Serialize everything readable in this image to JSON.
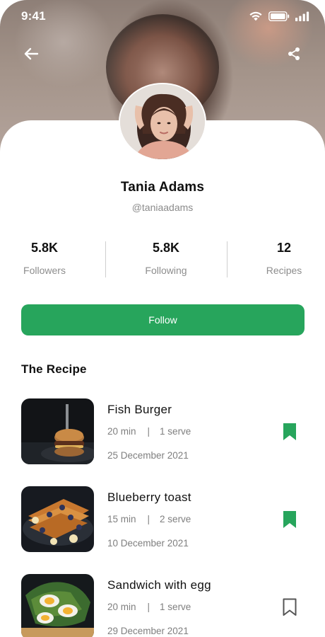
{
  "status_bar": {
    "time": "9:41"
  },
  "profile": {
    "name": "Tania Adams",
    "handle": "@taniaadams"
  },
  "stats": [
    {
      "value": "5.8K",
      "label": "Followers"
    },
    {
      "value": "5.8K",
      "label": "Following"
    },
    {
      "value": "12",
      "label": "Recipes"
    }
  ],
  "follow_label": "Follow",
  "section_title": "The Recipe",
  "recipes": [
    {
      "title": "Fish Burger",
      "time": "20 min",
      "serves": "1 serve",
      "date": "25 December 2021",
      "saved": true
    },
    {
      "title": "Blueberry toast",
      "time": "15 min",
      "serves": "2 serve",
      "date": "10 December 2021",
      "saved": true
    },
    {
      "title": "Sandwich with egg",
      "time": "20 min",
      "serves": "1 serve",
      "date": "29 December 2021",
      "saved": false
    }
  ],
  "separator": "|",
  "colors": {
    "accent": "#27a55c",
    "text": "#111111",
    "muted": "#8b8b8b"
  },
  "icons": {
    "back": "arrow-left-icon",
    "share": "share-icon",
    "bookmark": "bookmark-icon"
  }
}
